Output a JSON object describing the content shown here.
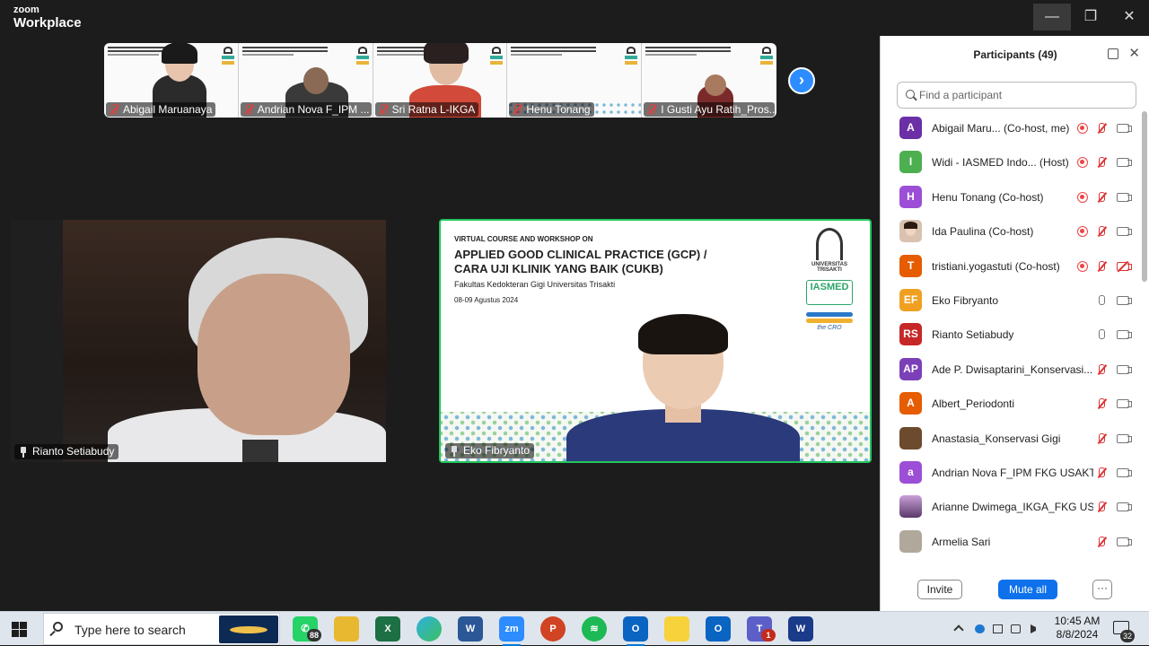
{
  "titlebar": {
    "brand_small": "zoom",
    "brand_large": "Workplace",
    "min_symbol": "—",
    "max_symbol": "❐",
    "close_symbol": "✕"
  },
  "gallery": {
    "thumbnails": [
      {
        "name": "Abigail Maruanaya"
      },
      {
        "name": "Andrian Nova F_IPM ..."
      },
      {
        "name": "Sri Ratna L-IKGA"
      },
      {
        "name": "Henu Tonang"
      },
      {
        "name": "I Gusti Ayu Ratih_Pros..."
      }
    ],
    "next_symbol": "›"
  },
  "main_videos": {
    "left": {
      "name": "Rianto Setiabudy"
    },
    "right": {
      "name": "Eko Fibryanto",
      "slide_line1": "VIRTUAL COURSE AND WORKSHOP ON",
      "slide_title_1": "APPLIED GOOD CLINICAL PRACTICE (GCP) /",
      "slide_title_2": "CARA UJI KLINIK YANG BAIK (CUKB)",
      "slide_subtitle": "Fakultas Kedokteran Gigi Universitas Trisakti",
      "slide_date": "08-09 Agustus 2024",
      "logo_uni": "UNIVERSITAS TRISAKTI",
      "logo_iasmed": "IASMED",
      "logo_cro": "the CRO"
    }
  },
  "participants": {
    "title": "Participants (49)",
    "search_placeholder": "Find a participant",
    "close_symbol": "✕",
    "list": [
      {
        "initials": "A",
        "color": "#6b2fa6",
        "name": "Abigail Maru... (Co-host, me)",
        "rec": true,
        "mic": "muted",
        "cam": "on"
      },
      {
        "initials": "I",
        "color": "#4caf50",
        "name": "Widi - IASMED Indo...  (Host)",
        "rec": true,
        "mic": "muted",
        "cam": "on"
      },
      {
        "initials": "H",
        "color": "#9c4fd6",
        "name": "Henu Tonang (Co-host)",
        "rec": true,
        "mic": "muted",
        "cam": "on"
      },
      {
        "initials": "",
        "color": "#d9c2b0",
        "name": "Ida Paulina (Co-host)",
        "rec": true,
        "mic": "muted",
        "cam": "on"
      },
      {
        "initials": "T",
        "color": "#e65c00",
        "name": "tristiani.yogastuti (Co-host)",
        "rec": true,
        "mic": "muted",
        "cam": "off"
      },
      {
        "initials": "EF",
        "color": "#f0a020",
        "name": "Eko Fibryanto",
        "rec": false,
        "mic": "on",
        "cam": "on"
      },
      {
        "initials": "RS",
        "color": "#c62828",
        "name": "Rianto Setiabudy",
        "rec": false,
        "mic": "on",
        "cam": "on"
      },
      {
        "initials": "AP",
        "color": "#7b3fb8",
        "name": "Ade P. Dwisaptarini_Konservasi...",
        "rec": false,
        "mic": "muted",
        "cam": "on"
      },
      {
        "initials": "A",
        "color": "#e65c00",
        "name": "Albert_Periodonti",
        "rec": false,
        "mic": "muted",
        "cam": "on"
      },
      {
        "initials": "",
        "color": "#6b4a2e",
        "name": "Anastasia_Konservasi Gigi",
        "rec": false,
        "mic": "muted",
        "cam": "on"
      },
      {
        "initials": "a",
        "color": "#9c4fd6",
        "name": "Andrian Nova F_IPM FKG USAKTI",
        "rec": false,
        "mic": "muted",
        "cam": "on"
      },
      {
        "initials": "",
        "color": "#8a6a9a",
        "name": "Arianne Dwimega_IKGA_FKG US...",
        "rec": false,
        "mic": "muted",
        "cam": "on"
      },
      {
        "initials": "",
        "color": "#b0a89a",
        "name": "Armelia Sari",
        "rec": false,
        "mic": "muted",
        "cam": "on"
      }
    ],
    "invite_label": "Invite",
    "mute_all_label": "Mute all",
    "more_label": "···"
  },
  "taskbar": {
    "search_placeholder": "Type here to search",
    "whatsapp_badge": "88",
    "teams_badge": "1",
    "time": "10:45 AM",
    "date": "8/8/2024",
    "notification_count": "32"
  }
}
